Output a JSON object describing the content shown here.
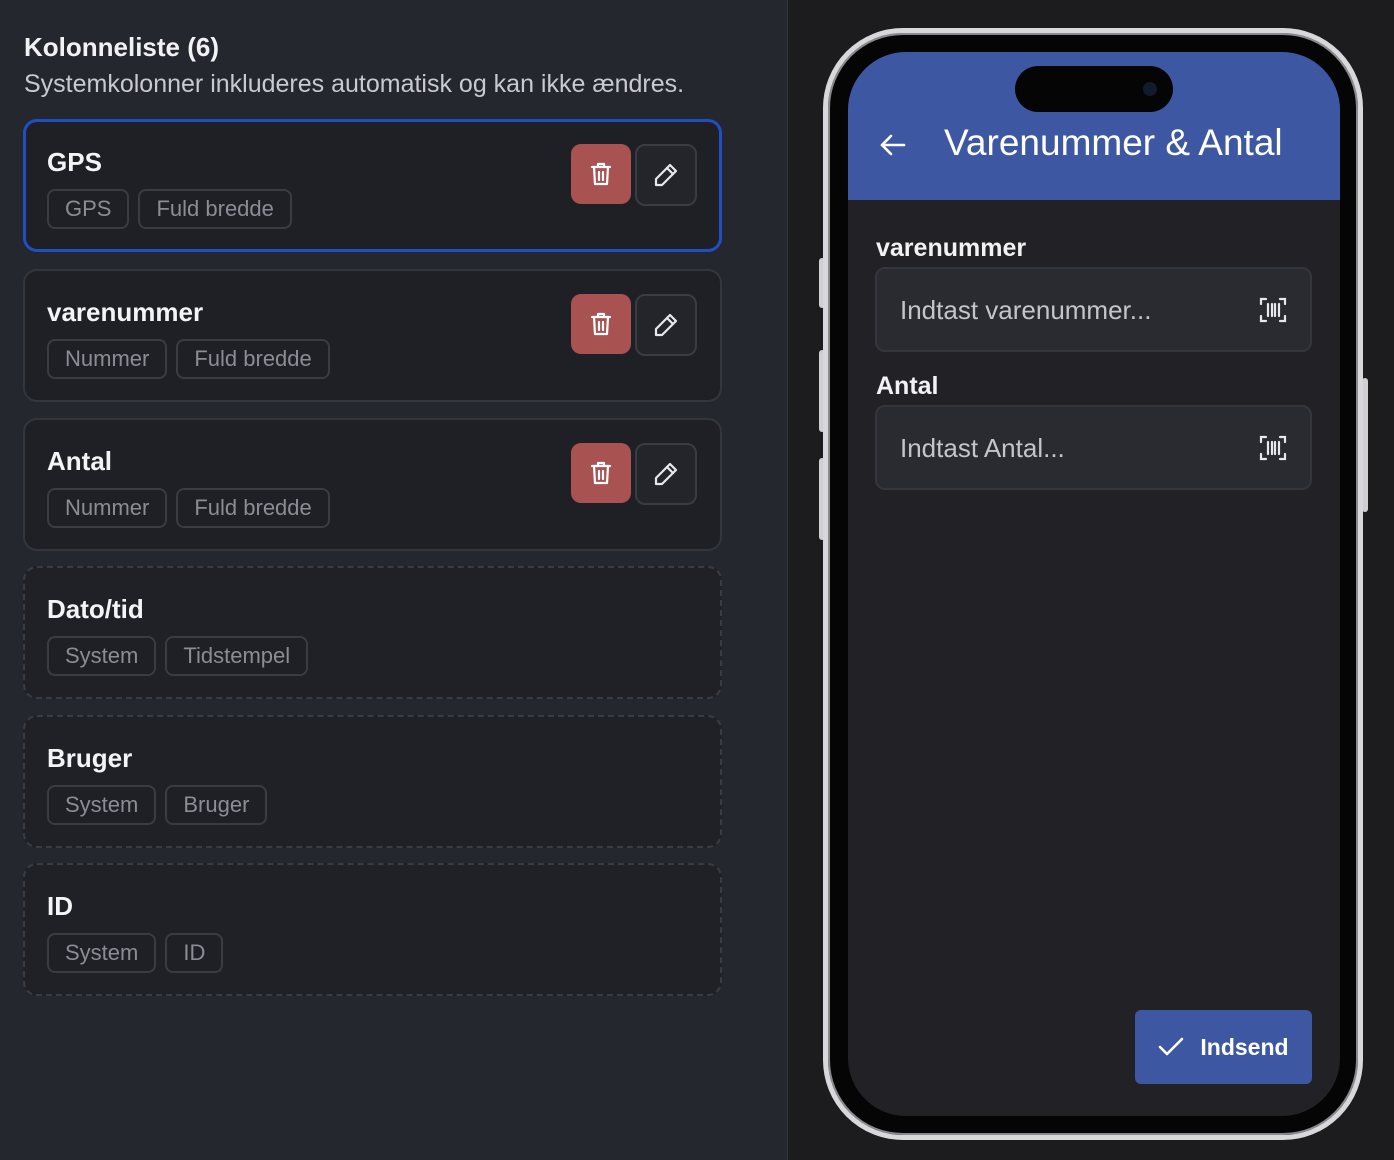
{
  "column_list": {
    "title": "Kolonneliste (6)",
    "subtitle": "Systemkolonner inkluderes automatisk og kan ikke ændres.",
    "columns": [
      {
        "name": "GPS",
        "tags": [
          "GPS",
          "Fuld bredde"
        ],
        "system": false,
        "selected": true
      },
      {
        "name": "varenummer",
        "tags": [
          "Nummer",
          "Fuld bredde"
        ],
        "system": false,
        "selected": false
      },
      {
        "name": "Antal",
        "tags": [
          "Nummer",
          "Fuld bredde"
        ],
        "system": false,
        "selected": false
      },
      {
        "name": "Dato/tid",
        "tags": [
          "System",
          "Tidstempel"
        ],
        "system": true,
        "selected": false
      },
      {
        "name": "Bruger",
        "tags": [
          "System",
          "Bruger"
        ],
        "system": true,
        "selected": false
      },
      {
        "name": "ID",
        "tags": [
          "System",
          "ID"
        ],
        "system": true,
        "selected": false
      }
    ]
  },
  "icons": {
    "delete": "trash-icon",
    "edit": "pencil-icon",
    "back": "arrow-left-icon",
    "scan": "barcode-scan-icon",
    "submit": "check-icon"
  },
  "colors": {
    "accent": "#3d57a3",
    "selected_border": "#1f4fc2",
    "delete": "#a85252"
  },
  "phone_preview": {
    "title": "Varenummer & Antal",
    "fields": [
      {
        "label": "varenummer",
        "placeholder": "Indtast varenummer..."
      },
      {
        "label": "Antal",
        "placeholder": "Indtast Antal..."
      }
    ],
    "submit_label": "Indsend"
  }
}
